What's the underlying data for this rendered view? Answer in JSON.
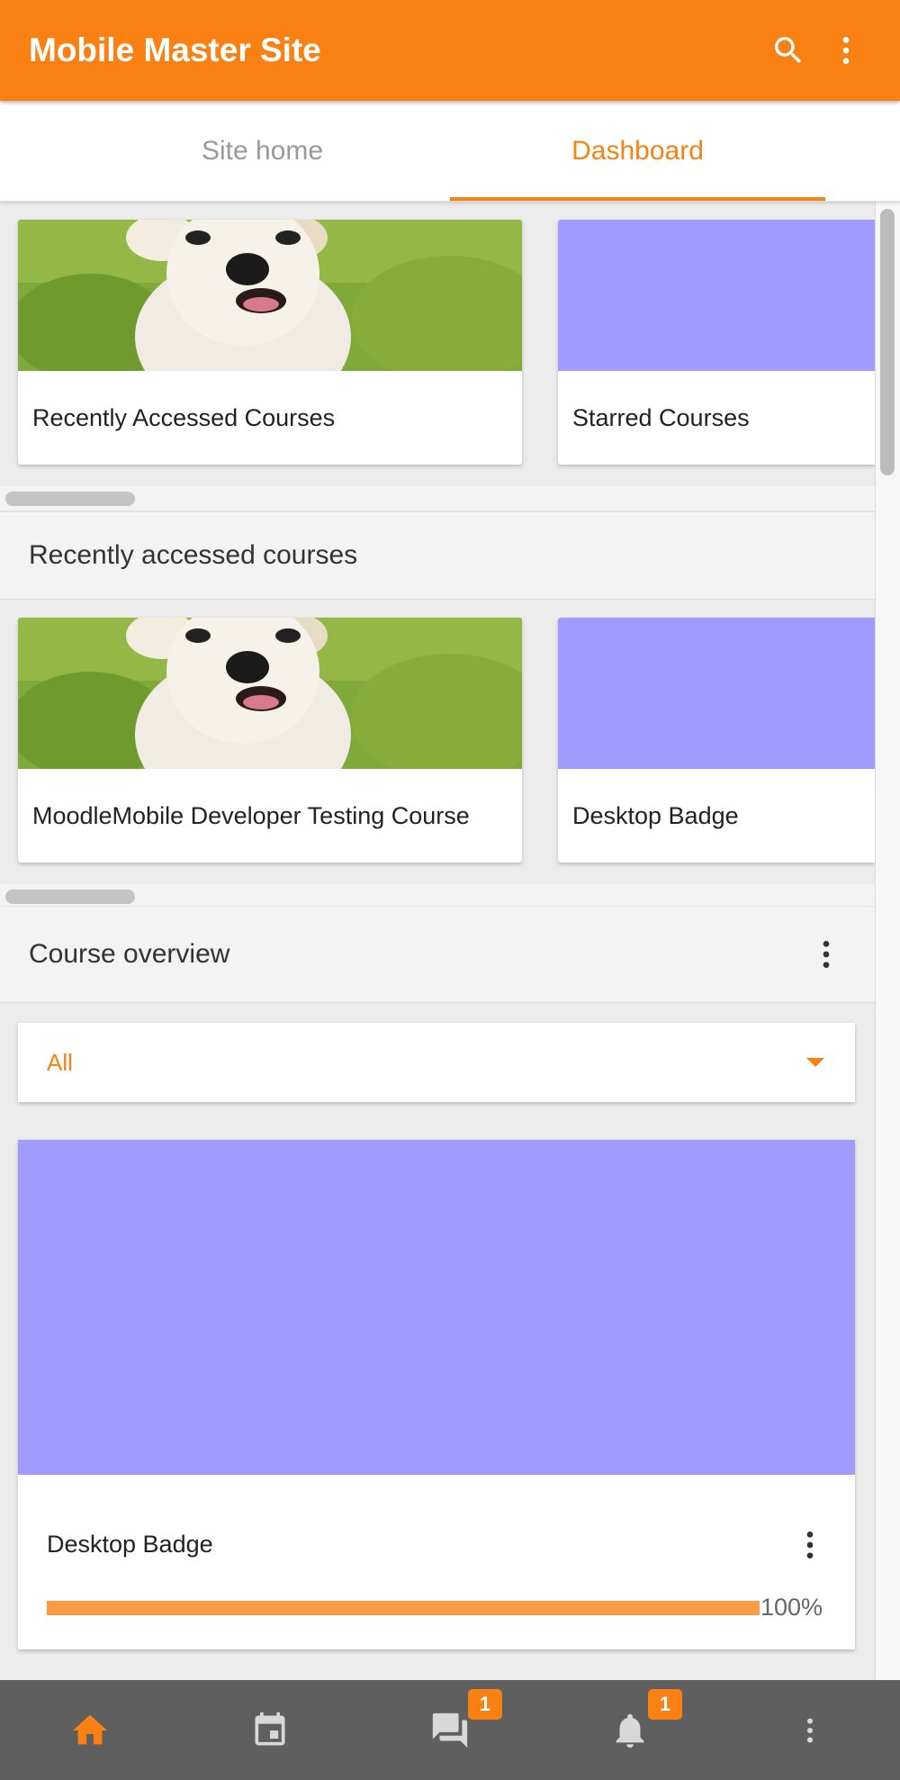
{
  "header": {
    "title": "Mobile Master Site",
    "search_icon": "search-icon",
    "menu_icon": "more-vertical-icon",
    "color": "#f98012"
  },
  "tabs": [
    {
      "label": "Site home",
      "active": false
    },
    {
      "label": "Dashboard",
      "active": true
    }
  ],
  "top_cards": [
    {
      "label": "Recently Accessed Courses",
      "image": "puppy-photo"
    },
    {
      "label": "Starred Courses",
      "image": "purple-placeholder"
    }
  ],
  "recent_section": {
    "title": "Recently accessed courses",
    "cards": [
      {
        "label": "MoodleMobile Developer Testing Course",
        "image": "puppy-photo"
      },
      {
        "label": "Desktop Badge",
        "image": "purple-placeholder"
      }
    ]
  },
  "overview": {
    "title": "Course overview",
    "filter_value": "All",
    "course": {
      "name": "Desktop Badge",
      "progress": 1.0,
      "progress_label": "100%",
      "image_color": "#a29bfe"
    }
  },
  "bottom_nav": [
    {
      "icon": "home-icon",
      "active": true,
      "badge": ""
    },
    {
      "icon": "calendar-icon",
      "active": false,
      "badge": ""
    },
    {
      "icon": "messages-icon",
      "active": false,
      "badge": "1"
    },
    {
      "icon": "notifications-bell-icon",
      "active": false,
      "badge": "1"
    },
    {
      "icon": "more-vertical-icon",
      "active": false,
      "badge": ""
    }
  ]
}
